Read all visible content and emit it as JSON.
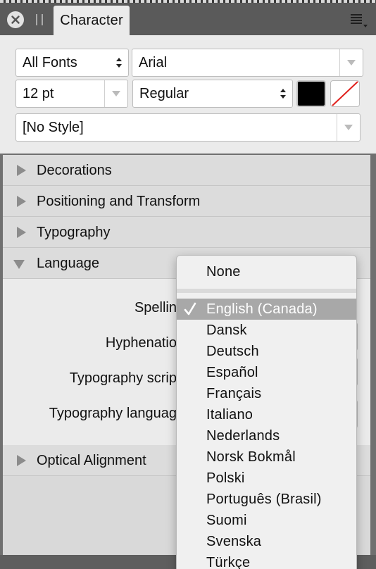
{
  "panel": {
    "tab_label": "Character",
    "close_icon": "close-icon",
    "menu_icon": "panel-menu-icon"
  },
  "controls": {
    "font_collection": "All Fonts",
    "font_family": "Arial",
    "font_size": "12 pt",
    "font_style": "Regular",
    "text_style": "[No Style]",
    "fill_color": "#000000",
    "stroke_color": "none"
  },
  "sections": {
    "decorations": "Decorations",
    "positioning": "Positioning and Transform",
    "typography": "Typography",
    "language": "Language",
    "optical": "Optical Alignment"
  },
  "language": {
    "spelling_label": "Spellin",
    "hyphenation_label": "Hyphenatio",
    "typography_script_label": "Typography scrip",
    "typography_language_label": "Typography languag"
  },
  "menu": {
    "none": "None",
    "selected": "English (Canada)",
    "items": [
      "Dansk",
      "Deutsch",
      "Español",
      "Français",
      "Italiano",
      "Nederlands",
      "Norsk Bokmål",
      "Polski",
      "Português (Brasil)",
      "Suomi",
      "Svenska",
      "Türkçe"
    ]
  },
  "colors": {
    "panel_bg": "#ebebeb",
    "section_bg": "#dcdcdc",
    "selection": "#a8a8a8",
    "tabstrip": "#5a5a5a"
  }
}
